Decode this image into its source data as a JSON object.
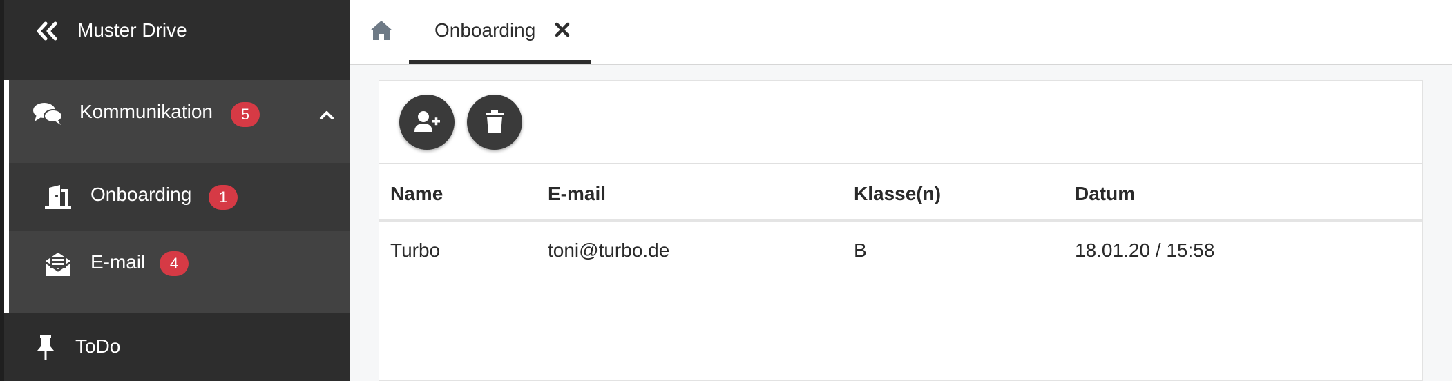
{
  "app": {
    "title": "Muster Drive"
  },
  "sidebar": {
    "group": {
      "label": "Kommunikation",
      "badge": "5",
      "icon": "comments-icon"
    },
    "items": [
      {
        "label": "Onboarding",
        "badge": "1",
        "icon": "door-open-icon"
      },
      {
        "label": "E-mail",
        "badge": "4",
        "icon": "envelope-open-text-icon"
      }
    ],
    "todo": {
      "label": "ToDo",
      "icon": "thumbtack-icon"
    }
  },
  "tabs": [
    {
      "label": "Onboarding"
    }
  ],
  "toolbar": {
    "add_icon": "user-plus-icon",
    "delete_icon": "trash-icon"
  },
  "table": {
    "columns": [
      "Name",
      "E-mail",
      "Klasse(n)",
      "Datum"
    ],
    "rows": [
      [
        "Turbo",
        "toni@turbo.de",
        "B",
        "18.01.20 / 15:58"
      ]
    ]
  },
  "colors": {
    "sidebar": "#2d2d2d",
    "sidebar_active": "#424242",
    "badge": "#d63a45",
    "fab": "#3a3a3a"
  }
}
